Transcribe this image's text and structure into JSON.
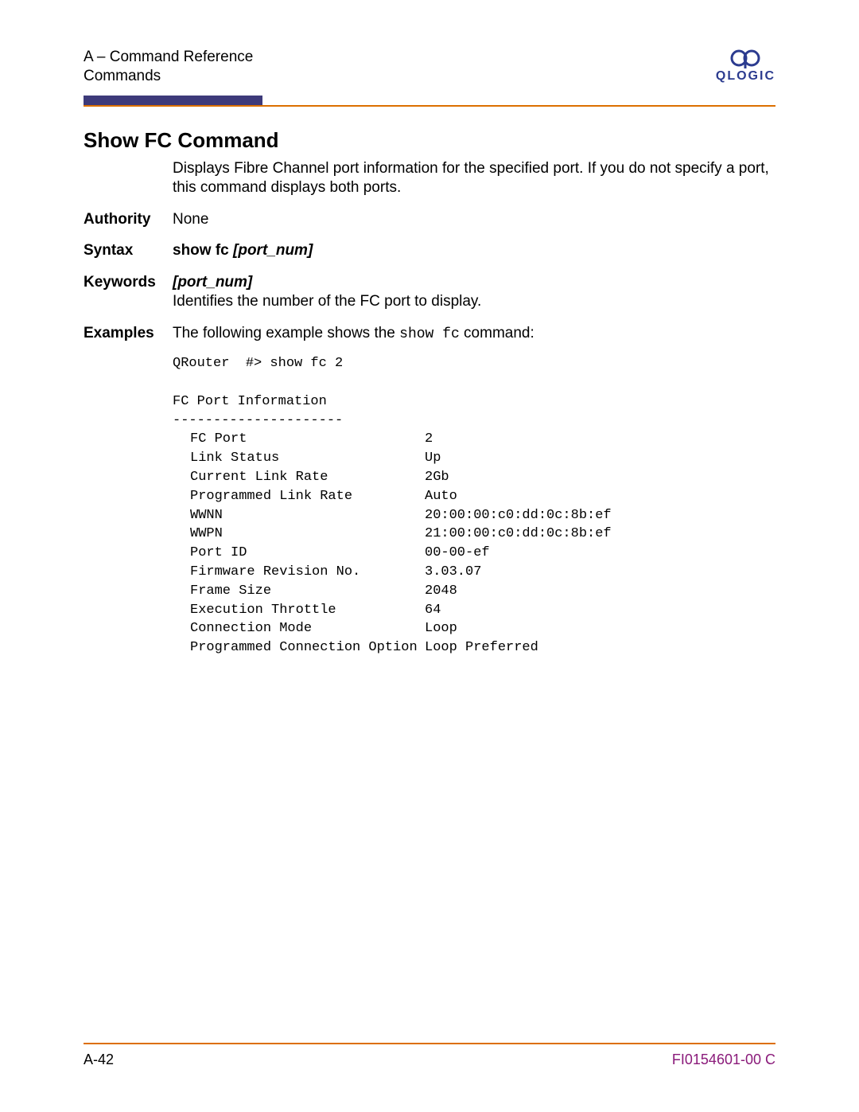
{
  "header": {
    "line1": "A – Command Reference",
    "line2": "Commands",
    "logo_word": "QLOGIC"
  },
  "title": "Show FC Command",
  "intro": "Displays Fibre Channel port information for the specified port. If you do not specify a port, this command displays both ports.",
  "authority": {
    "label": "Authority",
    "value": "None"
  },
  "syntax": {
    "label": "Syntax",
    "cmd": "show fc ",
    "arg": "[port_num]"
  },
  "keywords": {
    "label": "Keywords",
    "arg": "[port_num]",
    "desc": "Identifies the number of the FC port to display."
  },
  "examples": {
    "label": "Examples",
    "line_pre": "The following example shows the ",
    "cmd": "show fc",
    "line_post": " command:",
    "prompt": "QRouter  #> show fc 2",
    "block_title": "  FC Port Information",
    "block_rule": "  ---------------------",
    "rows": [
      {
        "k": "FC Port",
        "v": "2"
      },
      {
        "k": "Link Status",
        "v": "Up"
      },
      {
        "k": "Current Link Rate",
        "v": "2Gb"
      },
      {
        "k": "Programmed Link Rate",
        "v": "Auto"
      },
      {
        "k": "WWNN",
        "v": "20:00:00:c0:dd:0c:8b:ef"
      },
      {
        "k": "WWPN",
        "v": "21:00:00:c0:dd:0c:8b:ef"
      },
      {
        "k": "Port ID",
        "v": "00-00-ef"
      },
      {
        "k": "Firmware Revision No.",
        "v": "3.03.07"
      },
      {
        "k": "Frame Size",
        "v": "2048"
      },
      {
        "k": "Execution Throttle",
        "v": "64"
      },
      {
        "k": "Connection Mode",
        "v": "Loop"
      },
      {
        "k": "Programmed Connection Option",
        "v": "Loop Preferred"
      }
    ]
  },
  "footer": {
    "page": "A-42",
    "docnum": "FI0154601-00  C"
  }
}
